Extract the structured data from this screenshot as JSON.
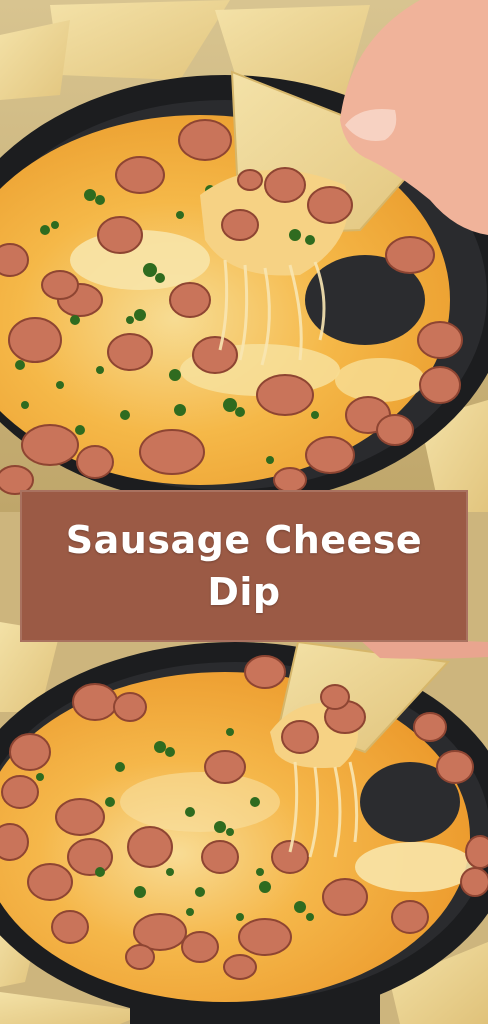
{
  "title": "Sausage Cheese Dip",
  "colors": {
    "banner": "#9b5a45",
    "banner_text": "#ffffff",
    "cheese": "#f2a531",
    "melted_cheese": "#f7d98a",
    "sausage": "#c9745a",
    "herbs": "#2f6b1f",
    "skillet": "#1c1d1f",
    "chips": "#efd99a"
  },
  "images": [
    {
      "label": "top-photo",
      "subject": "skillet of sausage cheese dip with tortilla chip lifting cheese pull"
    },
    {
      "label": "bottom-photo",
      "subject": "skillet of sausage cheese dip with tortilla chip lifting cheese pull"
    }
  ]
}
